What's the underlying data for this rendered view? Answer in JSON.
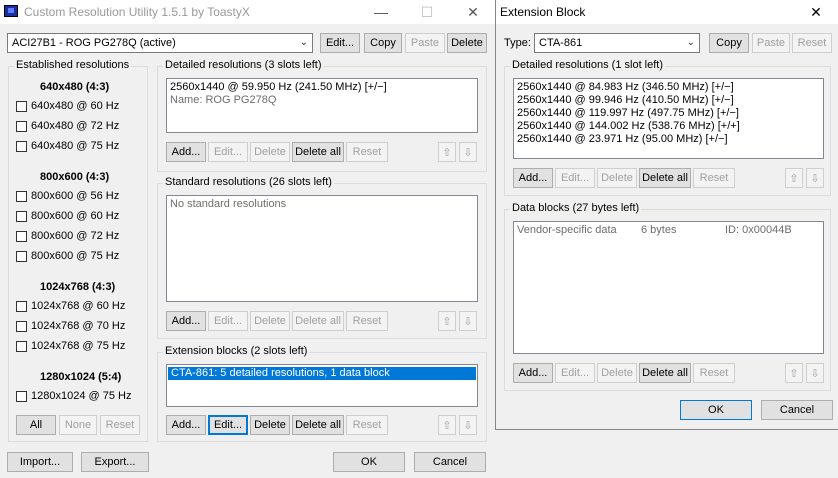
{
  "main": {
    "title": "Custom Resolution Utility 1.5.1 by ToastyX",
    "monitor_select": "ACI27B1 - ROG PG278Q (active)",
    "top_buttons": {
      "edit": "Edit...",
      "copy": "Copy",
      "paste": "Paste",
      "delete": "Delete"
    },
    "established": {
      "label": "Established resolutions",
      "groups": [
        {
          "heading": "640x480 (4:3)",
          "items": [
            "640x480 @ 60 Hz",
            "640x480 @ 72 Hz",
            "640x480 @ 75 Hz"
          ]
        },
        {
          "heading": "800x600 (4:3)",
          "items": [
            "800x600 @ 56 Hz",
            "800x600 @ 60 Hz",
            "800x600 @ 72 Hz",
            "800x600 @ 75 Hz"
          ]
        },
        {
          "heading": "1024x768 (4:3)",
          "items": [
            "1024x768 @ 60 Hz",
            "1024x768 @ 70 Hz",
            "1024x768 @ 75 Hz"
          ]
        },
        {
          "heading": "1280x1024 (5:4)",
          "items": [
            "1280x1024 @ 75 Hz"
          ]
        }
      ],
      "buttons": {
        "all": "All",
        "none": "None",
        "reset": "Reset"
      }
    },
    "detailed": {
      "label": "Detailed resolutions (3 slots left)",
      "rows": [
        "2560x1440 @ 59.950 Hz (241.50 MHz) [+/−]"
      ],
      "name_row": "Name: ROG PG278Q"
    },
    "standard": {
      "label": "Standard resolutions (26 slots left)",
      "empty": "No standard resolutions"
    },
    "extension": {
      "label": "Extension blocks (2 slots left)",
      "rows": [
        "CTA-861: 5 detailed resolutions, 1 data block"
      ]
    },
    "list_buttons": {
      "add": "Add...",
      "edit": "Edit...",
      "delete": "Delete",
      "delete_all": "Delete all",
      "reset": "Reset"
    },
    "bottom": {
      "import": "Import...",
      "export": "Export...",
      "ok": "OK",
      "cancel": "Cancel"
    }
  },
  "ext": {
    "title": "Extension Block",
    "type_label": "Type:",
    "type_value": "CTA-861",
    "top_buttons": {
      "copy": "Copy",
      "paste": "Paste",
      "reset": "Reset"
    },
    "detailed": {
      "label": "Detailed resolutions (1 slot left)",
      "rows": [
        "2560x1440 @ 84.983 Hz (346.50 MHz) [+/−]",
        "2560x1440 @ 99.946 Hz (410.50 MHz) [+/−]",
        "2560x1440 @ 119.997 Hz (497.75 MHz) [+/−]",
        "2560x1440 @ 144.002 Hz (538.76 MHz) [+/+]",
        "2560x1440 @ 23.971 Hz (95.00 MHz) [+/−]"
      ]
    },
    "data_blocks": {
      "label": "Data blocks (27 bytes left)",
      "row": {
        "name": "Vendor-specific data",
        "size": "6 bytes",
        "id": "ID: 0x00044B"
      }
    },
    "list_buttons": {
      "add": "Add...",
      "edit": "Edit...",
      "delete": "Delete",
      "delete_all": "Delete all",
      "reset": "Reset"
    },
    "bottom": {
      "ok": "OK",
      "cancel": "Cancel"
    }
  }
}
